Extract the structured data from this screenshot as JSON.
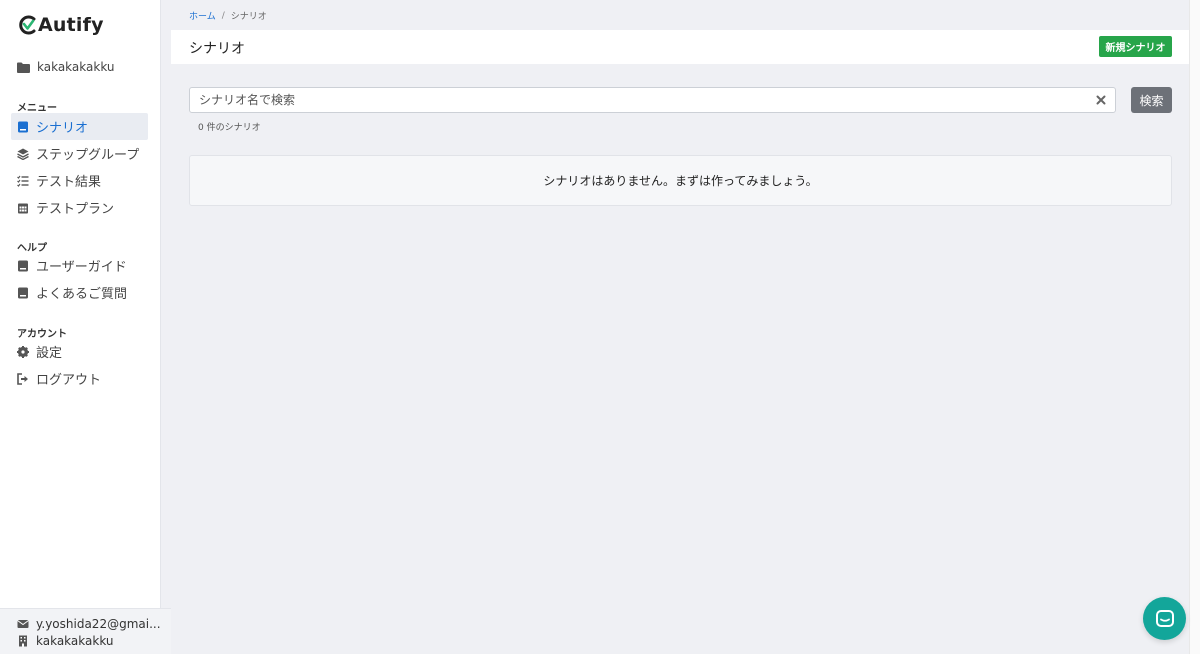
{
  "brand": {
    "name": "Autify"
  },
  "sidebar": {
    "workspace": "kakakakakku",
    "menu_label": "メニュー",
    "menu_items": [
      {
        "label": "シナリオ",
        "icon": "book-icon",
        "active": true
      },
      {
        "label": "ステップグループ",
        "icon": "layers-icon",
        "active": false
      },
      {
        "label": "テスト結果",
        "icon": "list-check-icon",
        "active": false
      },
      {
        "label": "テストプラン",
        "icon": "calendar-icon",
        "active": false
      }
    ],
    "help_label": "ヘルプ",
    "help_items": [
      {
        "label": "ユーザーガイド",
        "icon": "book-icon"
      },
      {
        "label": "よくあるご質問",
        "icon": "book-icon"
      }
    ],
    "account_label": "アカウント",
    "account_items": [
      {
        "label": "設定",
        "icon": "gear-icon"
      },
      {
        "label": "ログアウト",
        "icon": "sign-out-icon"
      }
    ],
    "footer": {
      "email": "y.yoshida22@gmai...",
      "organization": "kakakakakku"
    }
  },
  "breadcrumb": {
    "home": "ホーム",
    "separator": "/",
    "current": "シナリオ"
  },
  "header": {
    "title": "シナリオ",
    "new_button": "新規シナリオ"
  },
  "search": {
    "placeholder": "シナリオ名で検索",
    "value": "",
    "button": "検索"
  },
  "result_count": "0 件のシナリオ",
  "empty_message": "シナリオはありません。まずは作ってみましょう。",
  "colors": {
    "accent": "#1a6fd1",
    "primary_button": "#27a54a",
    "secondary_button": "#6d7178",
    "chat": "#13a69a",
    "background": "#eff0f4"
  }
}
